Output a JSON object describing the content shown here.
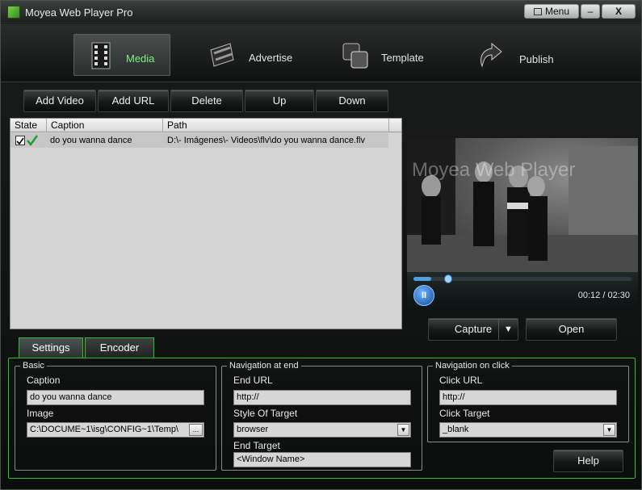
{
  "window": {
    "title": "Moyea Web Player Pro",
    "menu_label": "Menu",
    "minimize_label": "–",
    "close_label": "X"
  },
  "nav": {
    "tabs": [
      {
        "label": "Media",
        "icon": "film-reel-icon",
        "active": true
      },
      {
        "label": "Advertise",
        "icon": "film-strip-icon",
        "active": false
      },
      {
        "label": "Template",
        "icon": "template-icon",
        "active": false
      },
      {
        "label": "Publish",
        "icon": "publish-arrow-icon",
        "active": false
      }
    ]
  },
  "toolbar": {
    "add_video": "Add Video",
    "add_url": "Add URL",
    "delete": "Delete",
    "up": "Up",
    "down": "Down"
  },
  "media_list": {
    "columns": {
      "state": "State",
      "caption": "Caption",
      "path": "Path"
    },
    "rows": [
      {
        "checked": true,
        "caption": "do you wanna dance",
        "path": "D:\\- Imágenes\\- Videos\\flv\\do you wanna dance.flv"
      }
    ]
  },
  "preview": {
    "watermark": "Moyea Web Player",
    "current_time": "00:12",
    "total_time": "02:30",
    "time_display": "00:12 / 02:30",
    "progress_fraction": 0.08,
    "pause_label": "II",
    "capture_label": "Capture",
    "capture_arrow": "▼",
    "open_label": "Open"
  },
  "tabs": {
    "settings": "Settings",
    "encoder": "Encoder"
  },
  "basic": {
    "title": "Basic",
    "caption_label": "Caption",
    "caption_value": "do you wanna dance",
    "image_label": "Image",
    "image_value": "C:\\DOCUME~1\\isg\\CONFIG~1\\Temp\\",
    "browse_label": "..."
  },
  "nav_end": {
    "title": "Navigation at end",
    "end_url_label": "End URL",
    "end_url_value": "http://",
    "style_label": "Style Of Target",
    "style_value": "browser",
    "end_target_label": "End Target",
    "end_target_value": "<Window Name>"
  },
  "nav_click": {
    "title": "Navigation on click",
    "click_url_label": "Click URL",
    "click_url_value": "http://",
    "click_target_label": "Click Target",
    "click_target_value": "_blank"
  },
  "help_label": "Help",
  "colors": {
    "accent_green": "#2fbd3a",
    "active_nav": "#7ff07f",
    "progress_blue": "#4aa0e0"
  }
}
